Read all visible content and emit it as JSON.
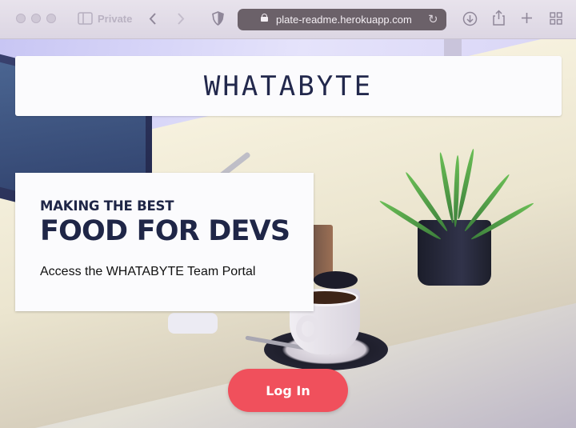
{
  "browser": {
    "private_label": "Private",
    "url": "plate-readme.herokuapp.com",
    "icons": [
      "close-window-icon",
      "minimize-window-icon",
      "zoom-window-icon",
      "sidebar-icon",
      "back-arrow-icon",
      "forward-arrow-icon",
      "privacy-shield-icon",
      "lock-icon",
      "reload-icon",
      "download-icon",
      "share-icon",
      "new-tab-plus-icon",
      "tab-overview-icon"
    ]
  },
  "header": {
    "brand": "WHATABYTE"
  },
  "hero": {
    "subtitle": "MAKING THE BEST",
    "title": "FOOD FOR DEVS",
    "portal_text": "Access the WHATABYTE Team Portal"
  },
  "actions": {
    "login_label": "Log In"
  },
  "colors": {
    "brand_navy": "#22284c",
    "login_red": "#f0505c"
  }
}
